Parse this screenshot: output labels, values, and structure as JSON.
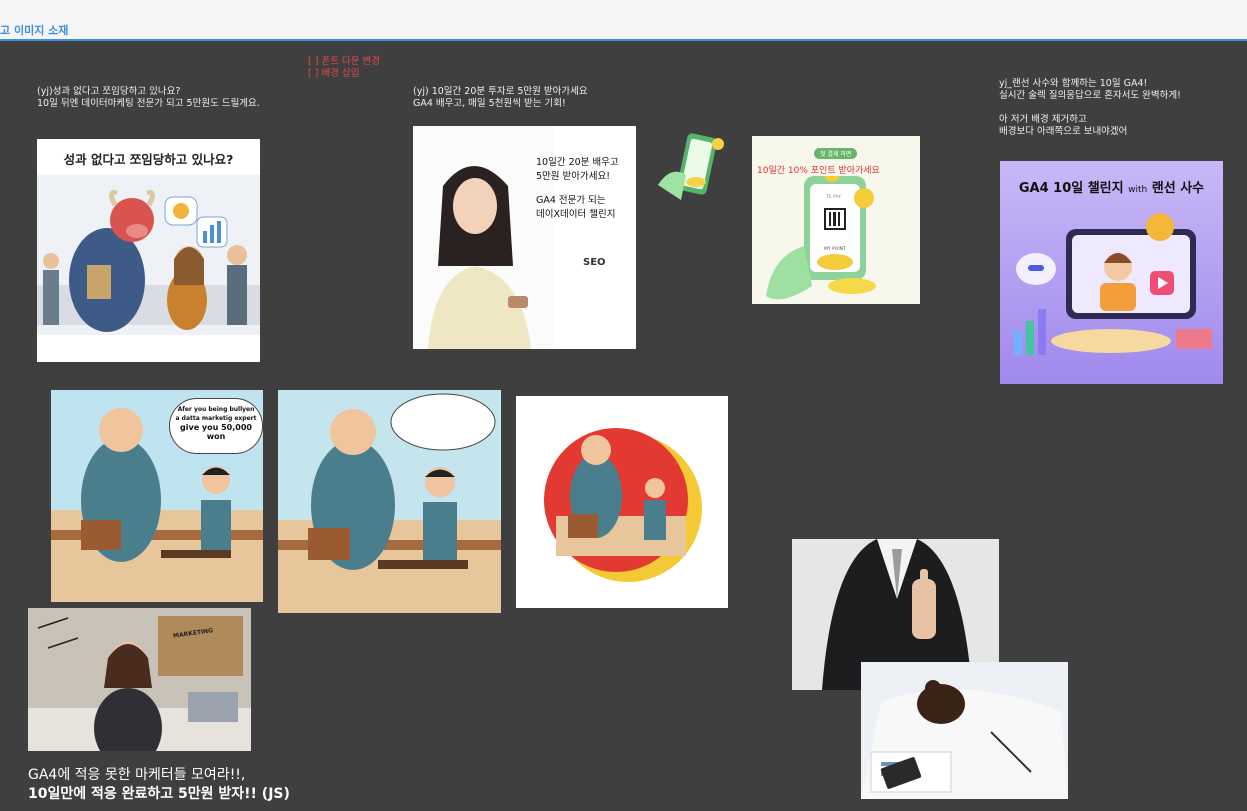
{
  "board": {
    "title": "고 이미지 소재",
    "todo": "[ ] 폰트 다운 변경\n[ ] 배경 삽입",
    "note1": "(yj)성과 없다고 쪼임당하고 있나요?\n10일 뒤엔 데이터마케팅 전문가 되고 5만원도 드릴게요.",
    "note2": "(yj) 10일간 20분 투자로 5만원 받아가세요\nGA4 배우고, 매일 5천원씩 받는 기회!",
    "note3": "yj_랜선 사수와 함께하는 10일 GA4!\n실시간 술렉 질의응답으로 혼자서도 완벽하게!\n\n아 저거 배경 제거하고\n배경보다 아래쪽으로 보내야겠어",
    "caption_line1": "GA4에 적응 못한 마케터들 모여라!!,",
    "caption_line2": "10일만에 적응 완료하고 5만원 받자!! (JS)"
  },
  "cards": {
    "card1_headline": "성과 없다고 쪼임당하고 있나요?",
    "card2_line1": "10일간 20분 배우고",
    "card2_line2": "5만원 받아가세요!",
    "card2_line3": "GA4 전문가 되는",
    "card2_line4": "데이X데이터 챌린지",
    "card2_logo": "SEO",
    "card3_badge": "첫 결제 하면",
    "card3_overlay": "10일간 10% 포인트 받아가세요",
    "card3_pay": "TE PAY",
    "card3_point": "MY POINT",
    "card4_title": "GA4 10일 챌린지",
    "card4_with": "with",
    "card4_title2": "랜선 사수",
    "comic_bubble_line1": "Afer you being bullyen",
    "comic_bubble_line2": "a datta marketig expert",
    "comic_bubble_line3": "give you 50,000 won",
    "board_text": "MARKETING"
  },
  "colors": {
    "canvas": "#3f3f3f",
    "accent": "#3d8fe0",
    "todo_red": "#e04848"
  }
}
